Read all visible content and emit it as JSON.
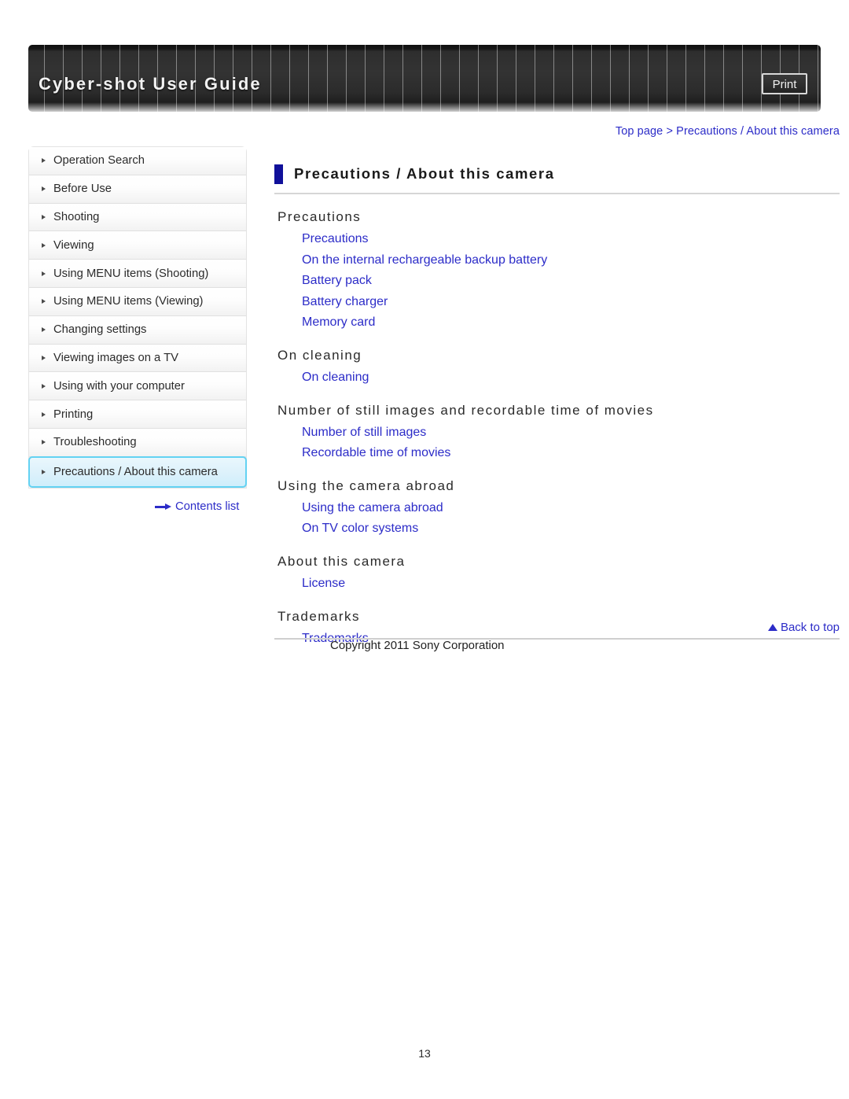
{
  "header": {
    "title": "Cyber-shot User Guide",
    "print_label": "Print"
  },
  "breadcrumb": {
    "top_page": "Top page",
    "separator": ">",
    "current": "Precautions / About this camera",
    "full": "Top page > Precautions / About this camera"
  },
  "sidebar": {
    "items": [
      {
        "label": "Operation Search",
        "active": false
      },
      {
        "label": "Before Use",
        "active": false
      },
      {
        "label": "Shooting",
        "active": false
      },
      {
        "label": "Viewing",
        "active": false
      },
      {
        "label": "Using MENU items (Shooting)",
        "active": false
      },
      {
        "label": "Using MENU items (Viewing)",
        "active": false
      },
      {
        "label": "Changing settings",
        "active": false
      },
      {
        "label": "Viewing images on a TV",
        "active": false
      },
      {
        "label": "Using with your computer",
        "active": false
      },
      {
        "label": "Printing",
        "active": false
      },
      {
        "label": "Troubleshooting",
        "active": false
      },
      {
        "label": "Precautions / About this camera",
        "active": true
      }
    ],
    "contents_list_label": "Contents list"
  },
  "main": {
    "page_title": "Precautions / About this camera",
    "sections": [
      {
        "heading": "Precautions",
        "links": [
          "Precautions",
          "On the internal rechargeable backup battery",
          "Battery pack",
          "Battery charger",
          "Memory card"
        ]
      },
      {
        "heading": "On cleaning",
        "links": [
          "On cleaning"
        ]
      },
      {
        "heading": "Number of still images and recordable time of movies",
        "links": [
          "Number of still images",
          "Recordable time of movies"
        ]
      },
      {
        "heading": "Using the camera abroad",
        "links": [
          "Using the camera abroad",
          "On TV color systems"
        ]
      },
      {
        "heading": "About this camera",
        "links": [
          "License"
        ]
      },
      {
        "heading": "Trademarks",
        "links": [
          "Trademarks"
        ]
      }
    ]
  },
  "footer": {
    "back_to_top": "Back to top",
    "copyright": "Copyright 2011 Sony Corporation",
    "page_number": "13"
  },
  "colors": {
    "link": "#2c2cc8",
    "title_accent": "#10109a",
    "active_nav_border": "#63d2f2",
    "banner_dark": "#2e2e2e"
  }
}
